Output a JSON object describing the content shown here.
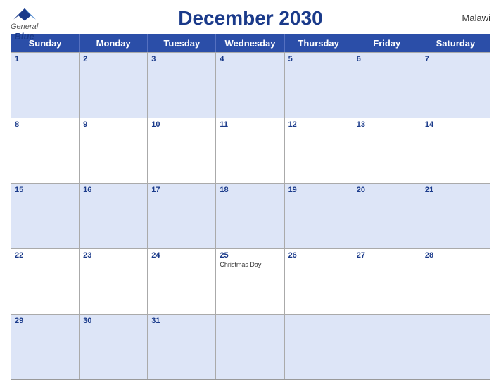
{
  "header": {
    "title": "December 2030",
    "country": "Malawi",
    "logo": {
      "general": "General",
      "blue": "Blue"
    }
  },
  "day_headers": [
    "Sunday",
    "Monday",
    "Tuesday",
    "Wednesday",
    "Thursday",
    "Friday",
    "Saturday"
  ],
  "weeks": [
    {
      "blue": true,
      "days": [
        {
          "num": "1",
          "event": ""
        },
        {
          "num": "2",
          "event": ""
        },
        {
          "num": "3",
          "event": ""
        },
        {
          "num": "4",
          "event": ""
        },
        {
          "num": "5",
          "event": ""
        },
        {
          "num": "6",
          "event": ""
        },
        {
          "num": "7",
          "event": ""
        }
      ]
    },
    {
      "blue": false,
      "days": [
        {
          "num": "8",
          "event": ""
        },
        {
          "num": "9",
          "event": ""
        },
        {
          "num": "10",
          "event": ""
        },
        {
          "num": "11",
          "event": ""
        },
        {
          "num": "12",
          "event": ""
        },
        {
          "num": "13",
          "event": ""
        },
        {
          "num": "14",
          "event": ""
        }
      ]
    },
    {
      "blue": true,
      "days": [
        {
          "num": "15",
          "event": ""
        },
        {
          "num": "16",
          "event": ""
        },
        {
          "num": "17",
          "event": ""
        },
        {
          "num": "18",
          "event": ""
        },
        {
          "num": "19",
          "event": ""
        },
        {
          "num": "20",
          "event": ""
        },
        {
          "num": "21",
          "event": ""
        }
      ]
    },
    {
      "blue": false,
      "days": [
        {
          "num": "22",
          "event": ""
        },
        {
          "num": "23",
          "event": ""
        },
        {
          "num": "24",
          "event": ""
        },
        {
          "num": "25",
          "event": "Christmas Day"
        },
        {
          "num": "26",
          "event": ""
        },
        {
          "num": "27",
          "event": ""
        },
        {
          "num": "28",
          "event": ""
        }
      ]
    },
    {
      "blue": true,
      "days": [
        {
          "num": "29",
          "event": ""
        },
        {
          "num": "30",
          "event": ""
        },
        {
          "num": "31",
          "event": ""
        },
        {
          "num": "",
          "event": ""
        },
        {
          "num": "",
          "event": ""
        },
        {
          "num": "",
          "event": ""
        },
        {
          "num": "",
          "event": ""
        }
      ]
    }
  ]
}
